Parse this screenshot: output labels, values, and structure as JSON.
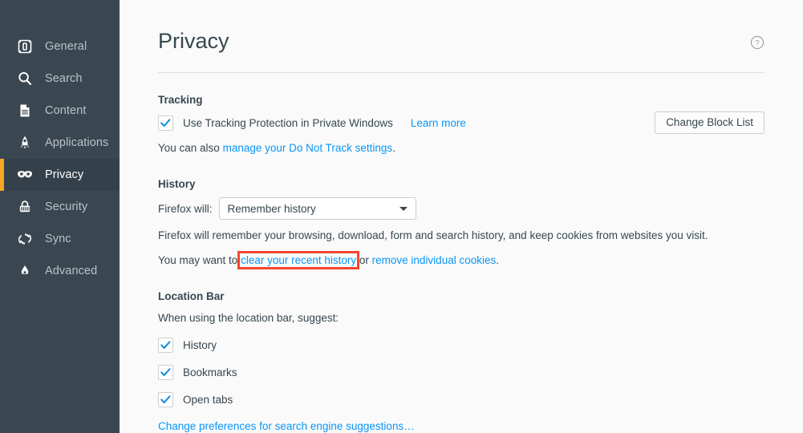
{
  "sidebar": {
    "items": [
      {
        "label": "General",
        "icon": "general-icon",
        "active": false
      },
      {
        "label": "Search",
        "icon": "search-icon",
        "active": false
      },
      {
        "label": "Content",
        "icon": "content-document-icon",
        "active": false
      },
      {
        "label": "Applications",
        "icon": "rocket-icon",
        "active": false
      },
      {
        "label": "Privacy",
        "icon": "mask-icon",
        "active": true
      },
      {
        "label": "Security",
        "icon": "padlock-icon",
        "active": false
      },
      {
        "label": "Sync",
        "icon": "sync-arrows-icon",
        "active": false
      },
      {
        "label": "Advanced",
        "icon": "flask-icon",
        "active": false
      }
    ],
    "active_indicator_color": "#f5a623",
    "background_color": "#3a4750"
  },
  "header": {
    "title": "Privacy",
    "help_icon": "help-circle-icon"
  },
  "tracking": {
    "section_title": "Tracking",
    "checkbox_label": "Use Tracking Protection in Private Windows",
    "checkbox_checked": true,
    "learn_more_label": "Learn more",
    "change_block_list_label": "Change Block List",
    "dnt_prefix": "You can also ",
    "dnt_link": "manage your Do Not Track settings",
    "dnt_suffix": "."
  },
  "history": {
    "section_title": "History",
    "select_label": "Firefox will:",
    "select_value": "Remember history",
    "description": "Firefox will remember your browsing, download, form and search history, and keep cookies from websites you visit.",
    "clear_prefix": "You may want to ",
    "clear_link": "clear your recent history",
    "clear_middle": " or ",
    "cookies_link": "remove individual cookies",
    "clear_suffix": "."
  },
  "location_bar": {
    "section_title": "Location Bar",
    "description": "When using the location bar, suggest:",
    "checkboxes": [
      {
        "label": "History",
        "checked": true
      },
      {
        "label": "Bookmarks",
        "checked": true
      },
      {
        "label": "Open tabs",
        "checked": true
      }
    ],
    "bottom_link": "Change preferences for search engine suggestions…"
  },
  "annotation": {
    "highlight_target": "clear your recent history",
    "highlight_color": "#f4452f"
  }
}
